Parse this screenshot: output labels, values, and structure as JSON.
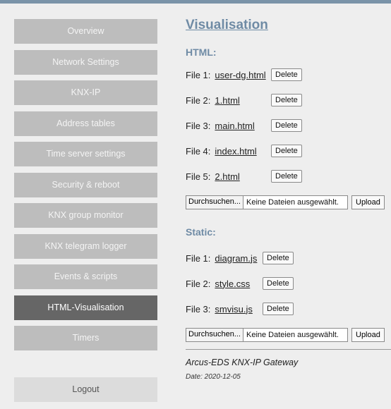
{
  "sidebar": {
    "items": [
      {
        "label": "Overview"
      },
      {
        "label": "Network Settings"
      },
      {
        "label": "KNX-IP"
      },
      {
        "label": "Address tables"
      },
      {
        "label": "Time server settings"
      },
      {
        "label": "Security & reboot"
      },
      {
        "label": "KNX group monitor"
      },
      {
        "label": "KNX telegram logger"
      },
      {
        "label": "Events & scripts"
      },
      {
        "label": "HTML-Visualisation",
        "active": true
      },
      {
        "label": "Timers"
      }
    ],
    "logout_label": "Logout"
  },
  "main": {
    "title": "Visualisation",
    "html_section": {
      "title": "HTML:",
      "files": [
        {
          "label": "File 1:",
          "name": "user-dg.html"
        },
        {
          "label": "File 2:",
          "name": "1.html"
        },
        {
          "label": "File 3:",
          "name": "main.html"
        },
        {
          "label": "File 4:",
          "name": "index.html"
        },
        {
          "label": "File 5:",
          "name": "2.html"
        }
      ]
    },
    "static_section": {
      "title": "Static:",
      "files": [
        {
          "label": "File 1:",
          "name": "diagram.js"
        },
        {
          "label": "File 2:",
          "name": "style.css"
        },
        {
          "label": "File 3:",
          "name": "smvisu.js"
        }
      ]
    },
    "delete_label": "Delete",
    "browse_label": "Durchsuchen...",
    "no_file_label": "Keine Dateien ausgewählt.",
    "upload_label": "Upload"
  },
  "footer": {
    "product": "Arcus-EDS KNX-IP Gateway",
    "date": "Date: 2020-12-05"
  },
  "colors": {
    "accent": "#6f8ba5",
    "nav_bg": "#bdbdbd",
    "nav_active_bg": "#666666"
  }
}
